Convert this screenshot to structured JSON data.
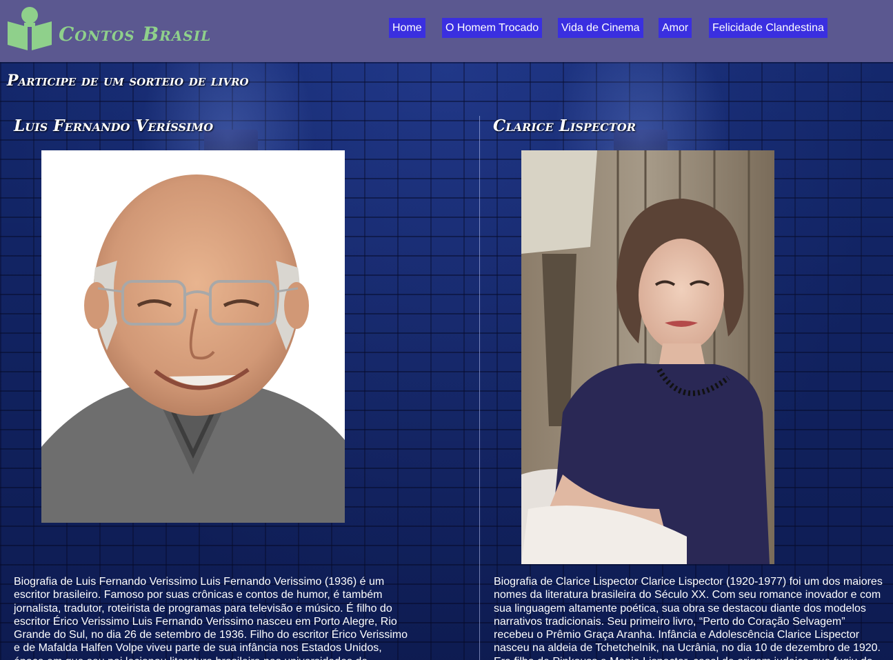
{
  "header": {
    "brand": "Contos Brasil",
    "nav": [
      "Home",
      "O Homem Trocado",
      "Vida de Cinema",
      "Amor",
      "Felicidade Clandestina"
    ]
  },
  "cta": "Participe de um sorteio de livro",
  "authors": [
    {
      "name": "Luis Fernando Veríssimo",
      "bio": "Biografia de Luis Fernando Verissimo Luis Fernando Verissimo (1936) é um escritor brasileiro. Famoso por suas crônicas e contos de humor, é também jornalista, tradutor, roteirista de programas para televisão e músico. É filho do escritor Érico Verissimo Luis Fernando Verissimo nasceu em Porto Alegre, Rio Grande do Sul, no dia 26 de setembro de 1936. Filho do escritor Érico Verissimo e de Mafalda Halfen Volpe viveu parte de sua infância nos Estados Unidos, época em que seu pai lecionou literatura brasileira nas universidades de"
    },
    {
      "name": "Clarice Lispector",
      "bio": "Biografia de Clarice Lispector Clarice Lispector (1920-1977) foi um dos maiores nomes da literatura brasileira do Século XX. Com seu romance inovador e com sua linguagem altamente poética, sua obra se destacou diante dos modelos narrativos tradicionais. Seu primeiro livro, “Perto do Coração Selvagem” recebeu o Prêmio Graça Aranha. Infância e Adolescência Clarice Lispector nasceu na aldeia de Tchetchelnik, na Ucrânia, no dia 10 de dezembro de 1920. Era filha de Pinkouss e Mania Lispector, casal de origem judaica que fugiu do seu país"
    }
  ],
  "colors": {
    "header_bg": "#5b5890",
    "nav_bg": "#3a2fe0",
    "brand": "#8fd08b",
    "wall": "#152a72"
  },
  "icons": {
    "logo": "reader-book-icon"
  }
}
